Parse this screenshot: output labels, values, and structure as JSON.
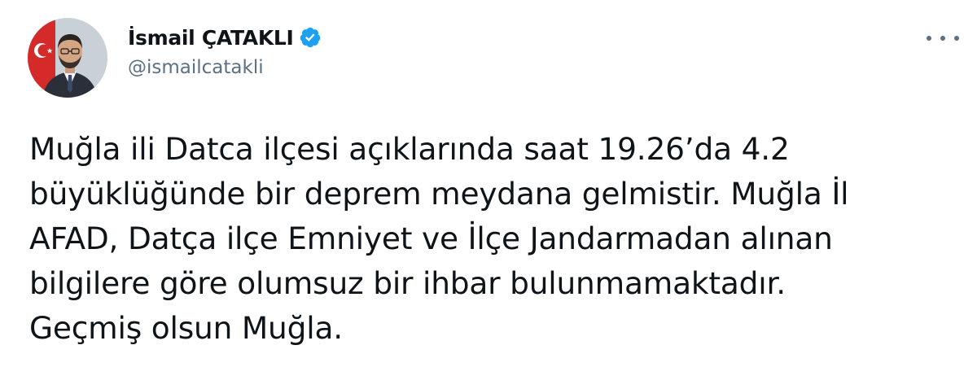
{
  "author": {
    "display_name": "İsmail ÇATAKLI",
    "handle": "@ismailcatakli",
    "verified": true,
    "avatar_icon": "profile-photo"
  },
  "menu": {
    "icon": "more-horizontal-icon"
  },
  "tweet": {
    "lines": [
      "Muğla ili Datca ilçesi açıklarında saat 19.26’da 4.2",
      "büyüklüğünde bir deprem meydana gelmistir. Muğla İl",
      "AFAD, Datça ilçe Emniyet ve İlçe Jandarmadan alınan",
      "bilgilere göre olumsuz bir ihbar bulunmamaktadır.",
      "Geçmiş olsun Muğla."
    ]
  },
  "colors": {
    "text_primary": "#0f1419",
    "text_secondary": "#5b7083",
    "verified_blue": "#1da1f2",
    "background": "#ffffff"
  }
}
